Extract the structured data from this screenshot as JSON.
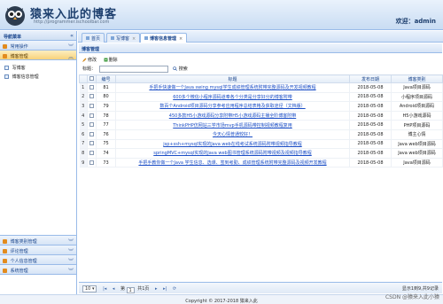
{
  "header": {
    "site_title": "猿来入此的博客",
    "site_url": "http://programmer.ischoolbar.com",
    "welcome": "欢迎：admin",
    "logo_icon": "owl-logo"
  },
  "sidebar": {
    "title": "导航菜单",
    "groups_top": [
      {
        "label": "常用操作",
        "active": false
      },
      {
        "label": "博客管理",
        "active": true
      }
    ],
    "items": [
      {
        "label": "写博客"
      },
      {
        "label": "博客信息管理"
      }
    ],
    "groups_bottom": [
      {
        "label": "博客类别管理"
      },
      {
        "label": "评论管理"
      },
      {
        "label": "个人信息管理"
      },
      {
        "label": "系统管理"
      }
    ]
  },
  "tabs": [
    {
      "label": "首页",
      "active": false
    },
    {
      "label": "写博客",
      "active": false
    },
    {
      "label": "博客信息管理",
      "active": true
    }
  ],
  "panel": {
    "title": "博客管理"
  },
  "toolbar": {
    "edit_label": "修改",
    "delete_label": "删除"
  },
  "search": {
    "label": "标题：",
    "value": "",
    "button_label": "搜索"
  },
  "table": {
    "columns": [
      "",
      "编号",
      "标题",
      "发布日期",
      "博客类别"
    ],
    "rows": [
      {
        "rn": "1",
        "id": "81",
        "title": "手把手快速做一个Java swing mysql学生成绩管理系统附带完整源码及开发视频教程",
        "date": "2018-05-08",
        "category": "Java项目源码"
      },
      {
        "rn": "2",
        "id": "80",
        "title": "600多个微信小程序源码道奉各个分类是分享好分的博客附带",
        "date": "2018-05-08",
        "category": "小程序项目源码"
      },
      {
        "rn": "3",
        "id": "79",
        "title": "数百个Android项目源码分享参考应用程序总结表格及获取途径（文档版）",
        "date": "2018-05-08",
        "category": "Android项目源码"
      },
      {
        "rn": "4",
        "id": "78",
        "title": "450多款H5小游戏源码分享附带H5小游戏源码主播全阶博客附带",
        "date": "2018-05-08",
        "category": "H5小游戏源码"
      },
      {
        "rn": "5",
        "id": "77",
        "title": "ThinkPHP仿网站三学市场mvp手机源码带控制视频教程复用",
        "date": "2018-05-08",
        "category": "PHP项目源码"
      },
      {
        "rn": "6",
        "id": "76",
        "title": "今天心情普通较好！",
        "date": "2018-05-08",
        "category": "博主心情"
      },
      {
        "rn": "7",
        "id": "75",
        "title": "jsp+ssh+mysql实现的Java web在线考试系统源码附带视频指导教程",
        "date": "2018-05-08",
        "category": "Java web项目源码"
      },
      {
        "rn": "8",
        "id": "74",
        "title": "springMVC+mysql实现的Java web图书管理系统源码附带视频及视频指导教程",
        "date": "2018-05-08",
        "category": "Java web项目源码"
      },
      {
        "rn": "9",
        "id": "73",
        "title": "手把手教你做一个Java 学生信息、选课、签到考勤、成绩管理系统附带完整源码及视频开发教程",
        "date": "2018-05-08",
        "category": "Java项目源码"
      }
    ]
  },
  "pager": {
    "page_size": "10",
    "page_label_before": "第",
    "page_value": "1",
    "page_label_after": "共1页",
    "summary": "显示1到9,共9记录"
  },
  "footer": {
    "copyright": "Copyright © 2017-2018 猿来入此"
  },
  "watermark": "CSDN @猿来入此小猿",
  "colors": {
    "accent": "#99bbe8",
    "active_group": "#f7d27a",
    "link": "#1b4ec6"
  }
}
